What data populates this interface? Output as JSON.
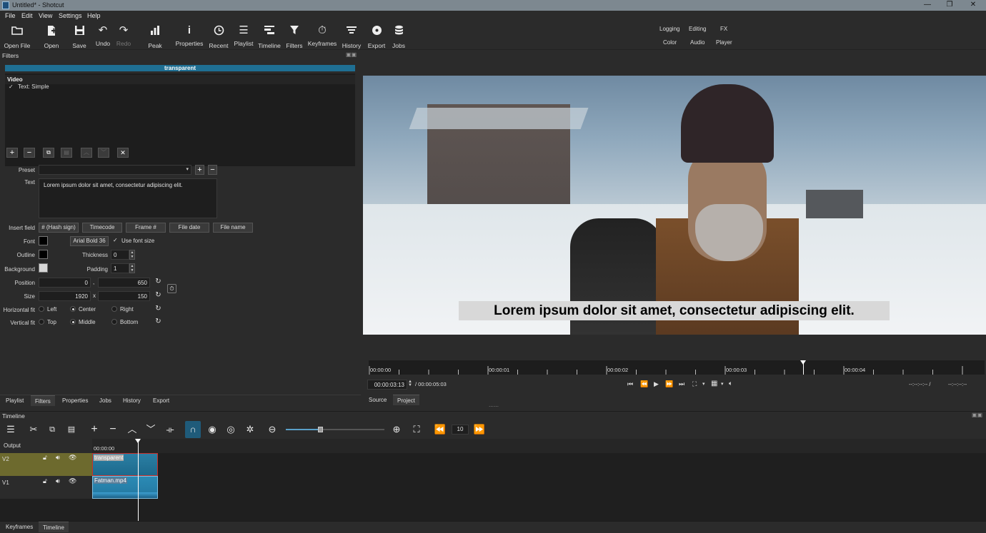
{
  "window": {
    "title": "Untitled* - Shotcut",
    "minimize": "—",
    "maximize": "❐",
    "close": "✕"
  },
  "menu": [
    "File",
    "Edit",
    "View",
    "Settings",
    "Help"
  ],
  "toolbar": [
    {
      "label": "Open File",
      "icon": "open-file-icon"
    },
    {
      "label": "Open Other..",
      "icon": "open-other-icon"
    },
    {
      "label": "Save",
      "icon": "save-icon"
    },
    {
      "label": "Undo",
      "icon": "undo-icon"
    },
    {
      "label": "Redo",
      "icon": "redo-icon"
    },
    {
      "label": "Peak Meter",
      "icon": "peak-meter-icon"
    },
    {
      "label": "Properties",
      "icon": "info-icon"
    },
    {
      "label": "Recent",
      "icon": "clock-icon"
    },
    {
      "label": "Playlist",
      "icon": "list-icon"
    },
    {
      "label": "Timeline",
      "icon": "timeline-icon"
    },
    {
      "label": "Filters",
      "icon": "funnel-icon"
    },
    {
      "label": "Keyframes",
      "icon": "stopwatch-icon"
    },
    {
      "label": "History",
      "icon": "history-icon"
    },
    {
      "label": "Export",
      "icon": "disc-icon"
    },
    {
      "label": "Jobs",
      "icon": "database-icon"
    }
  ],
  "layouts": {
    "row1": [
      "Logging",
      "Editing",
      "FX"
    ],
    "row2": [
      "Color",
      "Audio",
      "Player"
    ]
  },
  "filters": {
    "dock_title": "Filters",
    "current_clip": "transparent",
    "section": "Video",
    "items": [
      {
        "check": "✓",
        "name": "Text: Simple"
      }
    ],
    "preset_label": "Preset",
    "text_label": "Text",
    "text_value": "Lorem ipsum dolor sit amet, consectetur adipiscing elit.",
    "insert_field_label": "Insert field",
    "insert_buttons": [
      "# (Hash sign)",
      "Timecode",
      "Frame #",
      "File date",
      "File name"
    ],
    "font_label": "Font",
    "font_button": "Arial Bold 36",
    "use_font_size": "Use font size",
    "outline_label": "Outline",
    "thickness_label": "Thickness",
    "thickness_value": "0",
    "background_label": "Background",
    "padding_label": "Padding",
    "padding_value": "1",
    "position_label": "Position",
    "position_x": "0",
    "position_sep": ",",
    "position_y": "650",
    "size_label": "Size",
    "size_w": "1920",
    "size_sep": "x",
    "size_h": "150",
    "hfit_label": "Horizontal fit",
    "hfit_options": [
      "Left",
      "Center",
      "Right"
    ],
    "hfit_selected": 1,
    "vfit_label": "Vertical fit",
    "vfit_options": [
      "Top",
      "Middle",
      "Bottom"
    ],
    "vfit_selected": 1,
    "colors": {
      "font": "#000000",
      "outline": "#000000",
      "background": "#d8d8d8"
    }
  },
  "left_tabs": [
    "Playlist",
    "Filters",
    "Properties",
    "Jobs",
    "History",
    "Export"
  ],
  "left_tabs_selected": 1,
  "player": {
    "overlay_text": "Lorem ipsum dolor sit amet, consectetur adipiscing elit.",
    "ruler_labels": [
      "00:00:00",
      "00:00:01",
      "00:00:02",
      "00:00:03",
      "00:00:04"
    ],
    "current_time": "00:00:03:13",
    "total_time": "/ 00:00:05:03",
    "in_point": "--:--:--:-- /",
    "duration": "--:--:--:--",
    "tabs": [
      "Source",
      "Project"
    ],
    "tabs_selected": 1,
    "playhead_fraction": 0.705
  },
  "timeline": {
    "dock_title": "Timeline",
    "zoom_fraction": 0.35,
    "skip_value": "10",
    "output_label": "Output",
    "ruler_label": "00:00:00",
    "tracks": [
      {
        "name": "V2",
        "clip": "transparent"
      },
      {
        "name": "V1",
        "clip": "Fatman.mp4"
      }
    ]
  },
  "bottom_tabs": [
    "Keyframes",
    "Timeline"
  ],
  "bottom_tabs_selected": 1
}
